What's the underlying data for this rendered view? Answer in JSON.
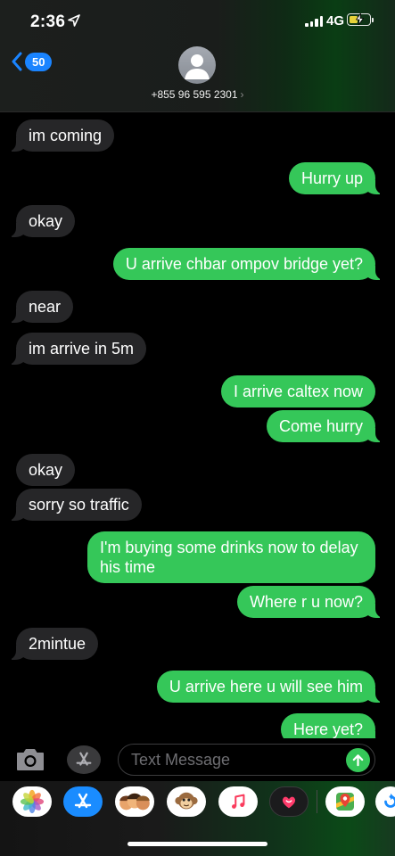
{
  "status": {
    "time": "2:36",
    "network": "4G"
  },
  "nav": {
    "unread_count": "50",
    "contact_number": "+855 96 595 2301",
    "contact_chevron": "›"
  },
  "messages": [
    {
      "dir": "in",
      "text": "im coming"
    },
    {
      "dir": "out",
      "text": "Hurry up"
    },
    {
      "dir": "in",
      "text": "okay"
    },
    {
      "dir": "out",
      "text": "U arrive chbar ompov bridge yet?"
    },
    {
      "dir": "in",
      "text": "near"
    },
    {
      "dir": "in",
      "text": "im arrive in 5m"
    },
    {
      "dir": "out",
      "text": "I arrive caltex now"
    },
    {
      "dir": "out",
      "text": "Come hurry"
    },
    {
      "dir": "in",
      "text": "okay"
    },
    {
      "dir": "in",
      "text": "sorry so traffic"
    },
    {
      "dir": "out",
      "text": "I'm buying some drinks now to delay his time"
    },
    {
      "dir": "out",
      "text": "Where r u now?"
    },
    {
      "dir": "in",
      "text": "2mintue"
    },
    {
      "dir": "out",
      "text": "U arrive here u will see him"
    },
    {
      "dir": "out",
      "text": "Here yet?"
    }
  ],
  "composer": {
    "placeholder": "Text Message"
  },
  "apps": [
    "photos-icon",
    "app-store-icon",
    "memoji-icon",
    "monkey-animoji-icon",
    "music-icon",
    "digital-touch-icon",
    "google-maps-icon",
    "partial-app-icon"
  ],
  "colors": {
    "sent_bubble": "#35c759",
    "received_bubble": "#262628",
    "badge": "#1a84ff",
    "background": "#000000"
  }
}
